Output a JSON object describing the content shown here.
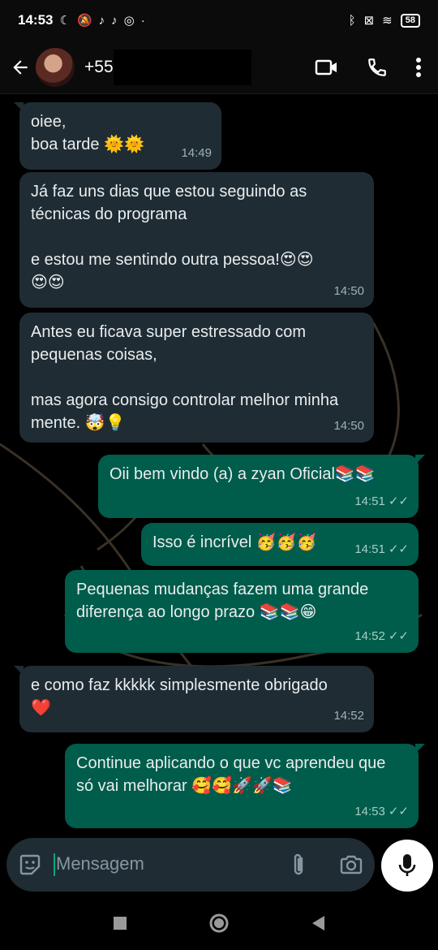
{
  "status_bar": {
    "time": "14:53",
    "battery": "58"
  },
  "header": {
    "contact_name": "+55"
  },
  "messages": [
    {
      "dir": "in",
      "text": "oiee,\nboa tarde 🌞🌞",
      "time": "14:49"
    },
    {
      "dir": "in",
      "text": "Já faz uns dias que estou seguindo as técnicas do programa\n\ne estou me sentindo outra pessoa!😍😍\n😍😍",
      "time": "14:50"
    },
    {
      "dir": "in",
      "text": "Antes eu ficava super estressado com pequenas coisas,\n\nmas agora consigo controlar melhor minha mente. 🤯💡",
      "time": "14:50"
    },
    {
      "dir": "out",
      "text": "Oii bem vindo (a) a zyan Oficial📚📚",
      "time": "14:51"
    },
    {
      "dir": "out",
      "text": "Isso é incrível 🥳🥳🥳",
      "time": "14:51"
    },
    {
      "dir": "out",
      "text": "Pequenas mudanças fazem uma grande diferença ao longo prazo 📚📚😁",
      "time": "14:52"
    },
    {
      "dir": "in",
      "text": "e como faz kkkkk simplesmente obrigado\n❤️",
      "time": "14:52"
    },
    {
      "dir": "out",
      "text": "Continue aplicando o que vc aprendeu que só vai melhorar 🥰🥰🚀🚀📚",
      "time": "14:53"
    }
  ],
  "input": {
    "placeholder": "Mensagem"
  },
  "colors": {
    "incoming_bubble": "#1f2c33",
    "outgoing_bubble": "#005c4b",
    "accent": "#00a884"
  }
}
